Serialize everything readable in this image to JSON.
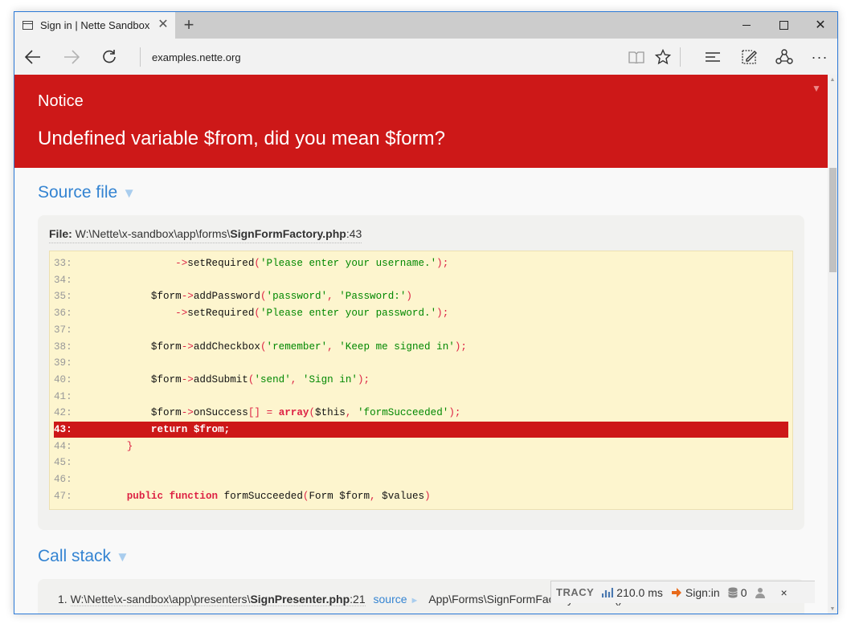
{
  "browser": {
    "tab_title": "Sign in | Nette Sandbox",
    "tab_close": "✕",
    "new_tab": "+",
    "address": "examples.nette.org",
    "more_label": "···",
    "window_close": "✕"
  },
  "error": {
    "type": "Notice",
    "message": "Undefined variable $from, did you mean $form?",
    "toggle": "▼"
  },
  "source_section": {
    "title": "Source file",
    "toggle_arrow": "▼",
    "file_label": "File:",
    "file_dir": "W:\\Nette\\x-sandbox\\app\\forms\\",
    "file_name": "SignFormFactory.php",
    "file_line": ":43",
    "code_lines": [
      {
        "num": "33:",
        "code": "\t\t\t\t->setRequired('Please enter your username.');"
      },
      {
        "num": "34:",
        "code": ""
      },
      {
        "num": "35:",
        "code": "\t\t\t$form->addPassword('password', 'Password:')"
      },
      {
        "num": "36:",
        "code": "\t\t\t\t->setRequired('Please enter your password.');"
      },
      {
        "num": "37:",
        "code": ""
      },
      {
        "num": "38:",
        "code": "\t\t\t$form->addCheckbox('remember', 'Keep me signed in');"
      },
      {
        "num": "39:",
        "code": ""
      },
      {
        "num": "40:",
        "code": "\t\t\t$form->addSubmit('send', 'Sign in');"
      },
      {
        "num": "41:",
        "code": ""
      },
      {
        "num": "42:",
        "code": "\t\t\t$form->onSuccess[] = array($this, 'formSucceeded');"
      },
      {
        "num": "43:",
        "code": "\t\t\treturn $from;"
      },
      {
        "num": "44:",
        "code": "\t\t}"
      },
      {
        "num": "45:",
        "code": ""
      },
      {
        "num": "46:",
        "code": ""
      },
      {
        "num": "47:",
        "code": "\t\tpublic function formSucceeded(Form $form, $values)"
      }
    ]
  },
  "call_stack": {
    "title": "Call stack",
    "toggle_arrow": "▼",
    "rows": [
      {
        "index": "1.",
        "file_dir": "W:\\Nette\\x-sandbox\\app\\presenters\\",
        "file_name": "SignPresenter.php",
        "file_line": ":21",
        "source_label": "source",
        "arrow": "►",
        "target": "App\\Forms\\SignFormFactory->create()"
      }
    ]
  },
  "tracy": {
    "logo": "TRACY",
    "time": "210.0 ms",
    "route": "Sign:in",
    "queries": "0",
    "close": "×"
  }
}
